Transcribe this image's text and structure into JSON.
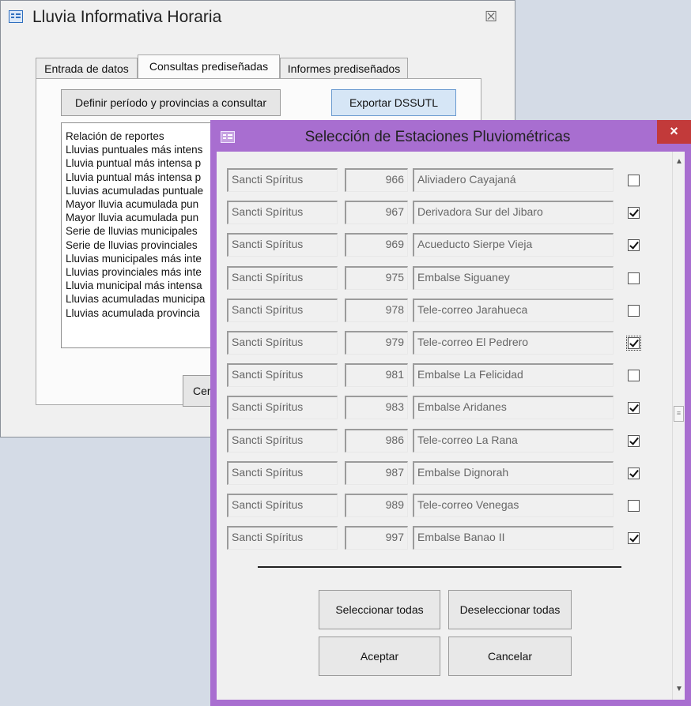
{
  "background_window": {
    "title": "Lluvia Informativa Horaria",
    "close_glyph": "☒",
    "tabs": [
      {
        "label": "Entrada de datos"
      },
      {
        "label": "Consultas prediseñadas"
      },
      {
        "label": "Informes prediseñados"
      }
    ],
    "define_button": "Definir período y provincias a consultar",
    "export_button": "Exportar DSSUTL",
    "report_list": [
      "Relación de reportes",
      "Lluvias puntuales más intens",
      "Lluvia puntual más intensa p",
      "Lluvia puntual más intensa p",
      "Lluvias acumuladas puntuale",
      "Mayor lluvia acumulada pun",
      "Mayor lluvia acumulada pun",
      "Serie de lluvias municipales",
      "Serie de lluvias provinciales",
      "Lluvias municipales más inte",
      "Lluvias provinciales más inte",
      "Lluvia municipal más intensa",
      "Lluvias acumuladas municipa",
      "Lluvias acumulada provincia"
    ],
    "close_button_partial": "Cer"
  },
  "dialog": {
    "title": "Selección de Estaciones Pluviométricas",
    "close_glyph": "×",
    "stations": [
      {
        "province": "Sancti Spíritus",
        "code": "966",
        "name": "Aliviadero Cayajaná",
        "checked": false
      },
      {
        "province": "Sancti Spíritus",
        "code": "967",
        "name": "Derivadora Sur del Jibaro",
        "checked": true
      },
      {
        "province": "Sancti Spíritus",
        "code": "969",
        "name": "Acueducto Sierpe Vieja",
        "checked": true
      },
      {
        "province": "Sancti Spíritus",
        "code": "975",
        "name": "Embalse Siguaney",
        "checked": false
      },
      {
        "province": "Sancti Spíritus",
        "code": "978",
        "name": "Tele-correo Jarahueca",
        "checked": false
      },
      {
        "province": "Sancti Spíritus",
        "code": "979",
        "name": "Tele-correo El Pedrero",
        "checked": true
      },
      {
        "province": "Sancti Spíritus",
        "code": "981",
        "name": "Embalse La Felicidad",
        "checked": false
      },
      {
        "province": "Sancti Spíritus",
        "code": "983",
        "name": "Embalse Aridanes",
        "checked": true
      },
      {
        "province": "Sancti Spíritus",
        "code": "986",
        "name": "Tele-correo La Rana",
        "checked": true
      },
      {
        "province": "Sancti Spíritus",
        "code": "987",
        "name": "Embalse Dignorah",
        "checked": true
      },
      {
        "province": "Sancti Spíritus",
        "code": "989",
        "name": "Tele-correo Venegas",
        "checked": false
      },
      {
        "province": "Sancti Spíritus",
        "code": "997",
        "name": "Embalse Banao II",
        "checked": true
      }
    ],
    "select_all_button": "Seleccionar todas",
    "deselect_all_button": "Deseleccionar todas",
    "accept_button": "Aceptar",
    "cancel_button": "Cancelar",
    "scroll_up_glyph": "▲",
    "scroll_down_glyph": "▼",
    "scroll_thumb_glyph": "≡"
  },
  "colors": {
    "dialog_frame": "#a86ed0",
    "dialog_close": "#c23a3a",
    "highlight_button": "#d6e6f6"
  }
}
